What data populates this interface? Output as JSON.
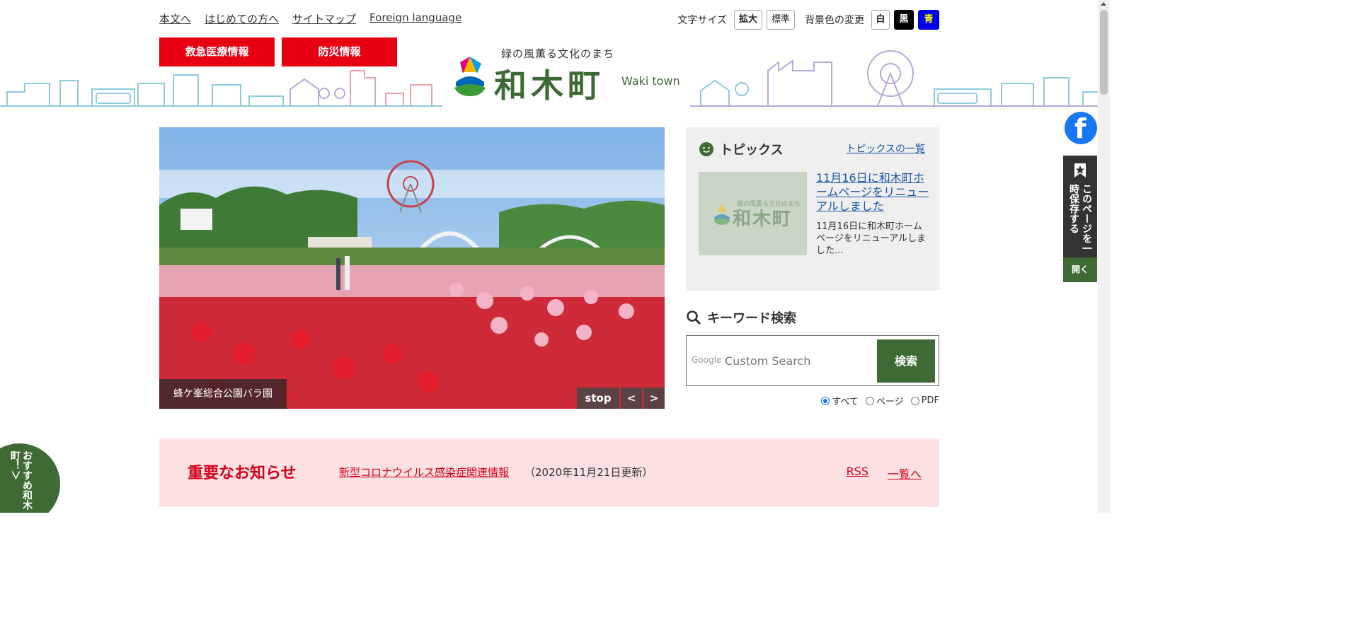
{
  "util_nav": {
    "links": [
      "本文へ",
      "はじめての方へ",
      "サイトマップ",
      "Foreign language"
    ]
  },
  "font_size": {
    "label": "文字サイズ",
    "enlarge": "拡大",
    "standard": "標準"
  },
  "background": {
    "label": "背景色の変更",
    "white": "白",
    "black": "黒",
    "blue": "青"
  },
  "emergency": {
    "medical": "救急医療情報",
    "disaster": "防災情報"
  },
  "logo": {
    "tagline": "緑の風薫る文化のまち",
    "name": "和木町",
    "english": "Waki town"
  },
  "hero": {
    "caption": "蜂ケ峯総合公園バラ園",
    "stop": "stop",
    "prev": "<",
    "next": ">"
  },
  "topics": {
    "heading": "トピックス",
    "all_link": "トピックスの一覧",
    "item": {
      "title": "11月16日に和木町ホームページをリニューアルしました",
      "desc": "11月16日に和木町ホームページをリニューアルしました...",
      "thumb_tagline": "緑の風薫る文化のまち",
      "thumb_name": "和木町"
    }
  },
  "search": {
    "heading": "キーワード検索",
    "google_label": "Google",
    "placeholder": "Custom Search",
    "button": "検索",
    "options": [
      "すべて",
      "ページ",
      "PDF"
    ]
  },
  "notice": {
    "title": "重要なお知らせ",
    "link": "新型コロナウイルス感染症関連情報",
    "updated": "（2020年11月21日更新）",
    "rss": "RSS",
    "list": "一覧へ"
  },
  "side": {
    "facebook": "f",
    "save": "このページを一時保存する",
    "open": "開く"
  },
  "recommend": {
    "label": "おすすめ和木町！＞"
  },
  "colors": {
    "emergency_red": "#e60012",
    "brand_green": "#3f6a35",
    "link_blue": "#1a57a8",
    "notice_bg": "#fde0e2"
  }
}
